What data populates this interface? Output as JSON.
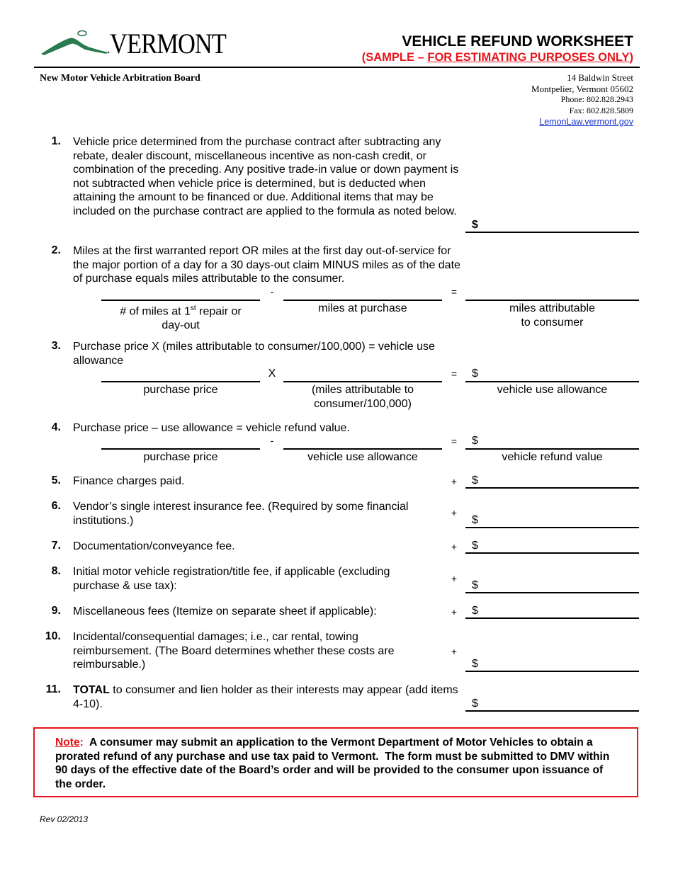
{
  "header": {
    "logo_text": "VERMONT",
    "logo_color": "#2a7a4f",
    "title": "VEHICLE REFUND WORKSHEET",
    "subtitle_prefix": "(SAMPLE – ",
    "subtitle_underlined": "FOR ESTIMATING PURPOSES ONLY",
    "subtitle_suffix": ")",
    "accent_color": "#e8141b",
    "board_name": "New Motor Vehicle Arbitration Board",
    "address": {
      "street": "14 Baldwin Street",
      "city": "Montpelier, Vermont 05602",
      "phone": "Phone:  802.828.2943",
      "fax": "Fax:  802.828.5809",
      "website": "LemonLaw.vermont.gov"
    }
  },
  "items": [
    {
      "number": "1.",
      "text": "Vehicle price determined from the purchase contract after subtracting any rebate, dealer discount, miscellaneous incentive as non-cash credit, or combination of the preceding.  Any positive trade-in value or down payment is not subtracted when vehicle price is determined, but is deducted when attaining the amount to be financed or due.  Additional items that may be included on the purchase contract are applied to the formula as noted below.",
      "currency": "$",
      "operator": ""
    },
    {
      "number": "2.",
      "text": "Miles at the first warranted report OR miles at the first day out-of-service for the major portion of a day for a 30 days-out claim MINUS miles as of the date of purchase equals miles attributable to the consumer.",
      "formula": {
        "op1": "-",
        "op2": "=",
        "cap1_a": "# of miles at 1",
        "cap1_sup": "st",
        "cap1_b": " repair or",
        "cap1_c": "day-out",
        "cap2": "miles at purchase",
        "cap3_a": "miles attributable",
        "cap3_b": "to consumer",
        "currency": ""
      }
    },
    {
      "number": "3.",
      "text": "Purchase price X (miles attributable to consumer/100,000) = vehicle use allowance",
      "formula": {
        "op1": "X",
        "op2": "=",
        "cap1": "purchase price",
        "cap2_a": "(miles attributable to",
        "cap2_b": "consumer/100,000)",
        "cap3": "vehicle use allowance",
        "currency": "$"
      }
    },
    {
      "number": "4.",
      "text": "Purchase price – use allowance = vehicle refund value.",
      "formula": {
        "op1": "-",
        "op2": "=",
        "cap1": "purchase price",
        "cap2": "vehicle use allowance",
        "cap3": "vehicle refund value",
        "currency": "$"
      }
    },
    {
      "number": "5.",
      "text": "Finance charges paid.",
      "operator": "+",
      "currency": "$"
    },
    {
      "number": "6.",
      "text": "Vendor’s single interest insurance fee. (Required by some financial institutions.)",
      "operator": "+",
      "currency": "$"
    },
    {
      "number": "7.",
      "text": "Documentation/conveyance fee.",
      "operator": "+",
      "currency": "$"
    },
    {
      "number": "8.",
      "text": "Initial motor vehicle registration/title fee, if applicable (excluding purchase & use tax):",
      "operator": "+",
      "currency": "$"
    },
    {
      "number": "9.",
      "text": "Miscellaneous fees (Itemize on separate sheet if applicable):",
      "operator": "+",
      "currency": "$"
    },
    {
      "number": "10.",
      "text": "Incidental/consequential damages; i.e., car rental, towing reimbursement.  (The Board determines whether these costs are reimbursable.)",
      "operator": "+",
      "currency": "$"
    },
    {
      "number": "11.",
      "text_bold": "TOTAL",
      "text": " to consumer and lien holder as their interests may appear (add items 4-10).",
      "operator": "",
      "currency": "$"
    }
  ],
  "note": {
    "label": "Note",
    "label_suffix": ":",
    "text": "  A consumer may submit an application to the Vermont Department of Motor Vehicles to obtain a prorated refund of any purchase and use tax paid to Vermont.  The form must be submitted to DMV within 90 days of the effective date of the Board’s order and will be provided to the consumer upon issuance of the order."
  },
  "footer": {
    "revision": "Rev 02/2013"
  }
}
